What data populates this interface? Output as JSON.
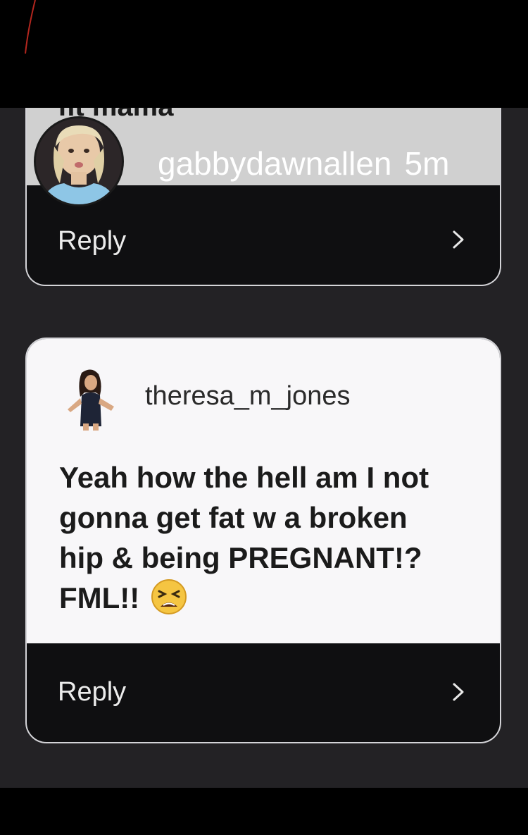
{
  "top_comment": {
    "cut_text": "fit mama",
    "username": "gabbydawnallen",
    "time": "5m",
    "reply_label": "Reply"
  },
  "bottom_comment": {
    "username": "theresa_m_jones",
    "text": "Yeah how the hell am I not gonna get fat w a broken hip & being PREGNANT!? FML!!",
    "emoji": "tired-face-emoji",
    "reply_label": "Reply"
  },
  "colors": {
    "background": "#232225",
    "card_dark": "#0f0f11",
    "card_light": "#f8f7f9",
    "quote_gray": "#d0d0d0"
  }
}
